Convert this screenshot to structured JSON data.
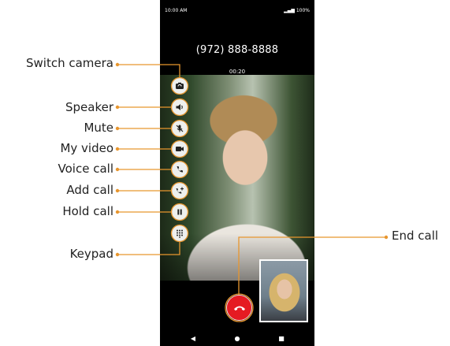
{
  "status_bar": {
    "time": "10:00 AM",
    "indicators": "100%"
  },
  "call": {
    "phone_number": "(972) 888-8888",
    "duration": "00:20"
  },
  "controls": [
    {
      "id": "switch-camera",
      "label": "Switch camera",
      "icon": "switch-camera-icon"
    },
    {
      "id": "speaker",
      "label": "Speaker",
      "icon": "speaker-icon"
    },
    {
      "id": "mute",
      "label": "Mute",
      "icon": "mute-mic-icon"
    },
    {
      "id": "my-video",
      "label": "My video",
      "icon": "video-camera-icon"
    },
    {
      "id": "voice-call",
      "label": "Voice call",
      "icon": "voice-call-icon"
    },
    {
      "id": "add-call",
      "label": "Add call",
      "icon": "add-call-icon"
    },
    {
      "id": "hold-call",
      "label": "Hold call",
      "icon": "pause-icon"
    },
    {
      "id": "keypad",
      "label": "Keypad",
      "icon": "keypad-icon"
    }
  ],
  "end_call": {
    "label": "End call",
    "icon": "end-call-icon"
  },
  "nav_bar": {
    "back": "◀",
    "home": "●",
    "recents": "■"
  },
  "colors": {
    "accent": "#e8962e",
    "end_call_red": "#e51b22"
  }
}
